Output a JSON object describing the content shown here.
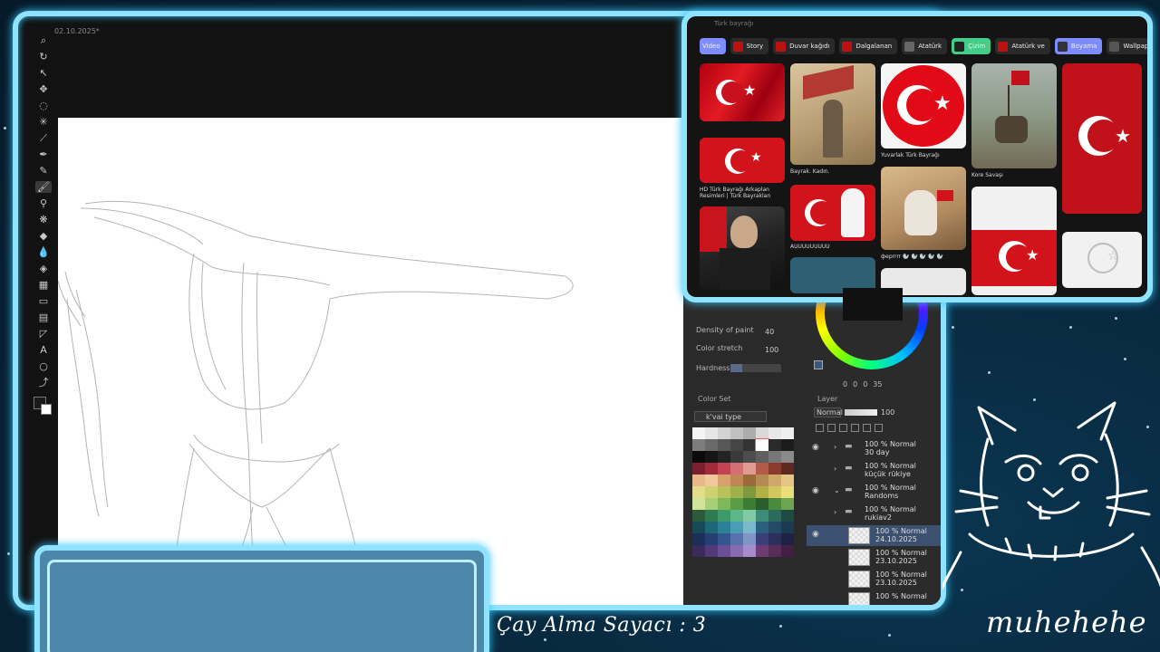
{
  "app": {
    "title": "02.10.2025*"
  },
  "toolbar": {
    "tools": [
      "zoom",
      "rotate",
      "object",
      "move",
      "lasso",
      "auto-select",
      "eyedropper",
      "pen",
      "pencil",
      "brush",
      "airbrush",
      "decoration",
      "eraser",
      "blend",
      "fill",
      "gradient",
      "figure",
      "frame",
      "ruler",
      "text",
      "balloon",
      "correct-line"
    ]
  },
  "brush_settings": {
    "density_label": "Density of paint",
    "density_value": "40",
    "stretch_label": "Color stretch",
    "stretch_value": "100",
    "hardness_label": "Hardness",
    "hardness_level": 0.24
  },
  "color_wheel": {
    "values": [
      "0",
      "0",
      "0",
      "35"
    ]
  },
  "color_set": {
    "tab_label": "Color Set",
    "select_value": "k'vai type",
    "swatches": [
      "#f4f4f4",
      "#e6e6e6",
      "#d3d3d3",
      "#c0c0c0",
      "#acacac",
      "#d9d9d9",
      "#e8e8e8",
      "#efefef",
      "#7d7d7d",
      "#6a6a6a",
      "#585858",
      "#454545",
      "#333333",
      "#ffffff",
      "#2a2a2a",
      "#1c1c1c",
      "#0a0a0a",
      "#151515",
      "#232323",
      "#3a3a3a",
      "#4d4d4d",
      "#5f5f5f",
      "#777777",
      "#8a8a8a",
      "#7a1f2e",
      "#a02c3a",
      "#c24452",
      "#d46f73",
      "#e09b93",
      "#b35b48",
      "#8a3b2d",
      "#5e2a20",
      "#e7b98a",
      "#f0c89c",
      "#d8a06d",
      "#c08756",
      "#9a6a3d",
      "#b48a52",
      "#cfa96a",
      "#e6c586",
      "#e4dc8a",
      "#cfd06f",
      "#b8c25a",
      "#9fb14b",
      "#7f9a3c",
      "#b2b144",
      "#d3c85d",
      "#e9df7a",
      "#cfe39a",
      "#a8cf78",
      "#7fb85a",
      "#5a9d44",
      "#3c7d36",
      "#2a5e2a",
      "#4a8a3f",
      "#6ea350",
      "#2c5a3a",
      "#2f7a52",
      "#3d9a6a",
      "#5db58a",
      "#82c9a6",
      "#3c8c77",
      "#2d6a5e",
      "#1f4a44",
      "#174a56",
      "#1f6677",
      "#2c8197",
      "#4a9db4",
      "#7ab8cc",
      "#2c5f7e",
      "#244b66",
      "#193a52",
      "#1b2f58",
      "#233f73",
      "#34568f",
      "#5674ab",
      "#7f96c4",
      "#3a3f7a",
      "#2c2f5e",
      "#1f2146",
      "#3a2a5a",
      "#52397a",
      "#6c4e97",
      "#8a6bb3",
      "#a68ccc",
      "#6f3b73",
      "#592c5a",
      "#431f44"
    ]
  },
  "layer_panel": {
    "tab_label": "Layer",
    "blend_mode": "Normal",
    "opacity": "100",
    "layers": [
      {
        "line1": "100 % Normal",
        "line2": "30 day",
        "type": "folder"
      },
      {
        "line1": "100 % Normal",
        "line2": "küçük rükiye",
        "type": "folder"
      },
      {
        "line1": "100 % Normal",
        "line2": "Randoms",
        "type": "folder"
      },
      {
        "line1": "100 % Normal",
        "line2": "rukiav2",
        "type": "folder"
      },
      {
        "line1": "100 % Normal",
        "line2": "24.10.2025",
        "type": "layer"
      },
      {
        "line1": "100 % Normal",
        "line2": "23.10.2025",
        "type": "layer"
      },
      {
        "line1": "100 % Normal",
        "line2": "23.10.2025",
        "type": "layer"
      },
      {
        "line1": "100 % Normal",
        "line2": "",
        "type": "layer"
      }
    ]
  },
  "pinterest": {
    "header": "Türk bayrağı",
    "chips": [
      "Video",
      "Story",
      "Duvar kağıdı",
      "Dalgalanan",
      "Atatürk",
      "Çizim",
      "Atatürk ve",
      "Boyama",
      "Wallpaper iphone"
    ],
    "captions": {
      "c1": "Bayrak. Kadın.",
      "c2": "Yuvarlak Türk Bayrağı",
      "c3": "Kore Savaşı",
      "c4": "HD Türk Bayrağı Arkaplan Resimleri | Türk Bayrakları",
      "c5": "AUUUUUUUUU",
      "c6": "ферrrrr 🦭 🦭 🦭 🦭 🦭"
    }
  },
  "overlay": {
    "counter": "Çay Alma Sayacı : 3",
    "signature": "muhehehe"
  }
}
